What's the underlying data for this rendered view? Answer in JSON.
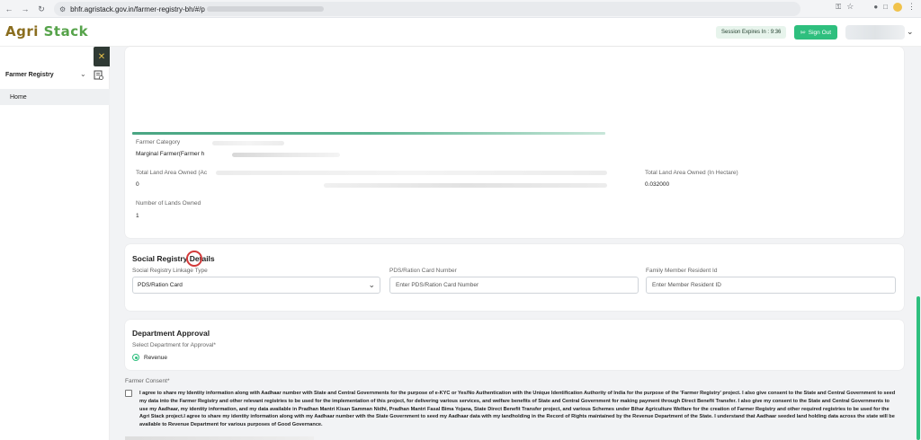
{
  "browser": {
    "url": "bhfr.agristack.gov.in/farmer-registry-bh/#/p"
  },
  "header": {
    "logo_part1": "Agri ",
    "logo_part2": "Stack",
    "session_text": "Session Expires In : 9:36",
    "signout_label": "Sign Out"
  },
  "sidebar": {
    "title": "Farmer Registry",
    "items": [
      {
        "label": "Home"
      }
    ]
  },
  "farmer_details": {
    "category_label": "Farmer Category",
    "category_value": "Marginal  Farmer(Farmer h",
    "land_owned_acre_label": "Total Land Area Owned (Ac",
    "land_owned_acre_value": "0",
    "land_owned_hectare_label": "Total Land Area Owned (In Hectare)",
    "land_owned_hectare_value": "0.032000",
    "lands_count_label": "Number of Lands Owned",
    "lands_count_value": "1"
  },
  "social_registry": {
    "title": "Social Registry Details",
    "linkage_label": "Social Registry Linkage Type",
    "linkage_value": "PDS/Ration Card",
    "pds_label": "PDS/Ration Card Number",
    "pds_placeholder": "Enter PDS/Ration Card Number",
    "member_label": "Family Member Resident Id",
    "member_placeholder": "Enter Member Resident ID"
  },
  "department": {
    "title": "Department Approval",
    "select_label": "Select Department for Approval*",
    "option": "Revenue"
  },
  "consent": {
    "label": "Farmer Consent*",
    "text": "I agree to share my Identity information along with Aadhaar number with State and Central Governments for the purpose of e-KYC or Yes/No Authentication with the Unique Identification Authority of India for the purpose of the 'Farmer Registry' project. I also give consent to the State and Central Government to seed my data into the Farmer Registry and other relevant registries to be used for the implementation of this project, for delivering various services, and welfare benefits of State and Central Government for making payment through Direct Benefit Transfer. I also give my consent to the State and Central Governments to use my Aadhaar, my identity information, and my data available in Pradhan Mantri Kisan Samman Nidhi, Pradhan Mantri Fasal Bima Yojana, State Direct Benefit Transfer project, and various Schemes under Bihar Agriculture Welfare for the creation of Farmer Registry and other required registries to be used for the Agri Stack project.I agree to share my identity information along with my Aadhaar number with the State Government to seed my Aadhaar data with my landholding in the Record of Rights maintained by the Revenue Department of the State. I understand that Aadhaar seeded land holding data across the state will be available to Revenue Department for various purposes of Good Governance."
  },
  "colors": {
    "accent": "#2ebf7e",
    "sidebar_dark": "#2f3a34"
  }
}
